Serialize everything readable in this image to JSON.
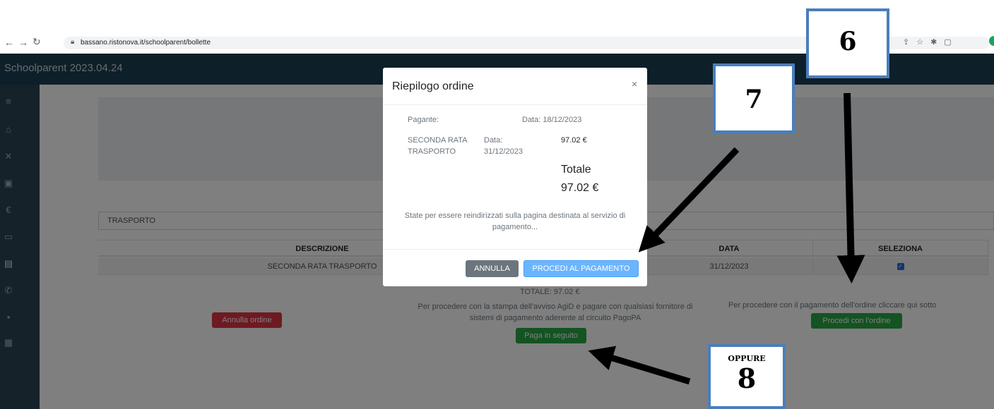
{
  "browser": {
    "url": "bassano.ristonova.it/schoolparent/bollette"
  },
  "app": {
    "title": "Schoolparent 2023.04.24"
  },
  "page": {
    "filter_value": "TRASPORTO",
    "table": {
      "headers": [
        "DESCRIZIONE",
        "DATA",
        "SELEZIONA"
      ],
      "rows": [
        {
          "descrizione": "SECONDA RATA TRASPORTO",
          "data": "31/12/2023"
        }
      ]
    },
    "totale": "TOTALE: 97.02 €",
    "note_left": "Per procedere con la stampa dell'avviso AgiD e pagare con qualsiasi fornitore di sistemi di pagamento aderente al circuito PagoPA",
    "note_right": "Per procedere con il pagamento dell'ordine cliccare qui sotto",
    "btn_annulla_ordine": "Annulla ordine",
    "btn_paga_seguito": "Paga in seguito",
    "btn_procedi_ordine": "Procedi con l'ordine"
  },
  "modal": {
    "title": "Riepilogo ordine",
    "close": "×",
    "pagante_label": "Pagante:",
    "data_header": "Data: 18/12/2023",
    "item_name_1": "SECONDA RATA",
    "item_name_2": "TRASPORTO",
    "item_date_label": "Data:",
    "item_date": "31/12/2023",
    "item_amount": "97.02 €",
    "totale_label": "Totale",
    "totale_value": "97.02 €",
    "redirect_text": "State per essere reindirizzati sulla pagina destinata al servizio di pagamento...",
    "btn_annulla": "ANNULLA",
    "btn_procedi": "PROCEDI AL PAGAMENTO"
  },
  "annotations": {
    "step6": "6",
    "step7": "7",
    "oppure": "OPPURE",
    "step8": "8"
  }
}
